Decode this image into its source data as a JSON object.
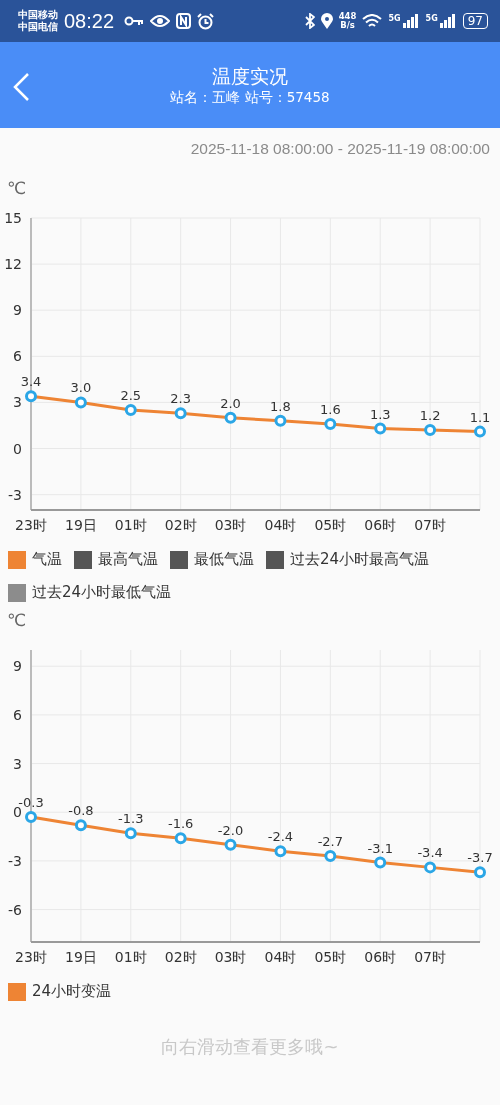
{
  "status_bar": {
    "carriers": [
      "中国移动",
      "中国电信"
    ],
    "time": "08:22",
    "speed": [
      "448",
      "B/s"
    ],
    "signals": [
      {
        "label": "5G"
      },
      {
        "label": "5G"
      }
    ],
    "battery": "97"
  },
  "header": {
    "title": "温度实况",
    "subtitle": "站名：五峰 站号：57458"
  },
  "date_range": "2025-11-18 08:00:00 - 2025-11-19 08:00:00",
  "charts": [
    {
      "unit": "℃",
      "chart_data": {
        "type": "line",
        "categories": [
          "23时",
          "19日",
          "01时",
          "02时",
          "03时",
          "04时",
          "05时",
          "06时",
          "07时",
          null
        ],
        "ylim": [
          -4,
          15
        ],
        "grid": true,
        "yticks": [
          -3,
          0,
          3,
          6,
          9,
          12,
          15
        ],
        "series": [
          {
            "name": "气温",
            "color": "#ee8434",
            "marker": "circle",
            "values": [
              3.4,
              3.0,
              2.5,
              2.3,
              2.0,
              1.8,
              1.6,
              1.3,
              1.2,
              1.1
            ]
          }
        ],
        "value_labels": [
          "3.4",
          "3.0",
          "2.5",
          "2.3",
          "2.0",
          "1.8",
          "1.6",
          "1.3",
          "1.2",
          "1.1"
        ]
      },
      "legend": [
        {
          "label": "最高气温",
          "color": "#555555"
        },
        {
          "label": "最低气温",
          "color": "#555555"
        },
        {
          "label": "过去24小时最高气温",
          "color": "#555555"
        },
        {
          "label": "过去24小时最低气温",
          "color": "#8c8c8c"
        }
      ]
    },
    {
      "unit": "℃",
      "chart_data": {
        "type": "line",
        "categories": [
          "23时",
          "19日",
          "01时",
          "02时",
          "03时",
          "04时",
          "05时",
          "06时",
          "07时",
          null
        ],
        "ylim": [
          -8,
          10
        ],
        "grid": true,
        "yticks": [
          -6,
          -3,
          0,
          3,
          6,
          9
        ],
        "series": [
          {
            "name": "24小时变温",
            "color": "#ee8434",
            "marker": "circle",
            "values": [
              -0.3,
              -0.8,
              -1.3,
              -1.6,
              -2.0,
              -2.4,
              -2.7,
              -3.1,
              -3.4,
              -3.7
            ]
          }
        ],
        "value_labels": [
          "-0.3",
          "-0.8",
          "-1.3",
          "-1.6",
          "-2.0",
          "-2.4",
          "-2.7",
          "-3.1",
          "-3.4",
          "-3.7"
        ]
      }
    }
  ],
  "footer_hint": "向右滑动查看更多哦~"
}
